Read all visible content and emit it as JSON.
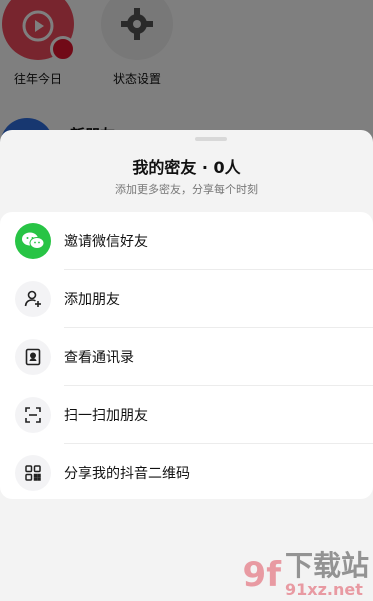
{
  "background": {
    "items": [
      {
        "label": "往年今日",
        "icon": "history-replay-icon"
      },
      {
        "label": "状态设置",
        "icon": "gear-icon"
      }
    ],
    "friend_name": "新朋友"
  },
  "sheet": {
    "title": "我的密友 · 0人",
    "subtitle": "添加更多密友，分享每个时刻",
    "options": [
      {
        "label": "邀请微信好友",
        "icon": "wechat-icon"
      },
      {
        "label": "添加朋友",
        "icon": "add-user-icon"
      },
      {
        "label": "查看通讯录",
        "icon": "contacts-icon"
      },
      {
        "label": "扫一扫加朋友",
        "icon": "scan-icon"
      },
      {
        "label": "分享我的抖音二维码",
        "icon": "qr-code-icon"
      }
    ]
  },
  "watermark": {
    "big": "9f",
    "top": "下载站",
    "bottom": "91xz.net"
  },
  "colors": {
    "wechat_green": "#28c445",
    "accent_red": "#e3142f"
  }
}
